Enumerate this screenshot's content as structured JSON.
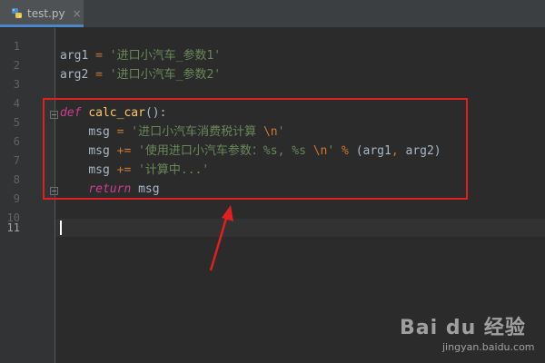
{
  "tab": {
    "filename": "test.py",
    "close_glyph": "×"
  },
  "gutter": {
    "line_numbers": [
      "1",
      "2",
      "3",
      "4",
      "5",
      "6",
      "7",
      "8",
      "9",
      "10",
      "11"
    ],
    "active_line": "11"
  },
  "code": {
    "line2": {
      "var": "arg1",
      "op": " = ",
      "str": "'进口小汽车_参数1'"
    },
    "line3": {
      "var": "arg2",
      "op": " = ",
      "str": "'进口小汽车_参数2'"
    },
    "line5": {
      "def_kw": "def",
      "space": " ",
      "fn": "calc_car",
      "rest": "():"
    },
    "line6": {
      "indent": "    ",
      "var": "msg",
      "op": " = ",
      "str1": "'进口小汽车消费税计算 ",
      "esc": "\\n",
      "str2": "'"
    },
    "line7": {
      "indent": "    ",
      "var": "msg",
      "op": " += ",
      "str1": "'使用进口小汽车参数：%s, %s ",
      "esc": "\\n",
      "str2": "'",
      "mod": " % ",
      "args_open": "(arg1",
      "comma": ",",
      "args_close": " arg2)"
    },
    "line8": {
      "indent": "    ",
      "var": "msg",
      "op": " += ",
      "str": "'计算中...'"
    },
    "line9": {
      "indent": "    ",
      "ret_kw": "return",
      "rest": " msg"
    }
  },
  "colors": {
    "background": "#2b2b2b",
    "keyword": "#cc3e8f",
    "string": "#6a8759",
    "function": "#ffc66d",
    "highlight_box": "#e02020"
  },
  "icons": {
    "tab_icon": "python-file-icon"
  },
  "watermark": {
    "logo": "Bai du 经验",
    "url": "jingyan.baidu.com"
  }
}
